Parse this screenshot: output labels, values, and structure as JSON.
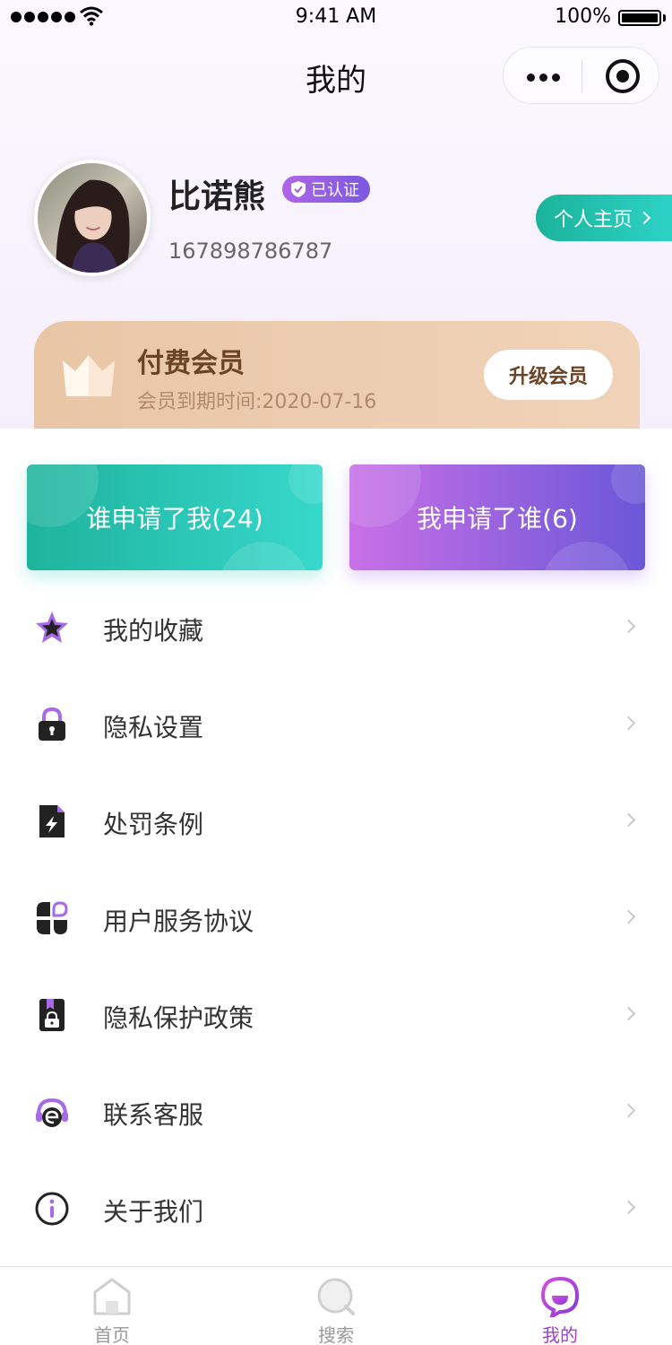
{
  "status_bar": {
    "time": "9:41 AM",
    "battery": "100%"
  },
  "nav": {
    "title": "我的"
  },
  "profile": {
    "name": "比诺熊",
    "verified_badge": "已认证",
    "phone": "167898786787",
    "homepage_label": "个人主页"
  },
  "membership": {
    "title": "付费会员",
    "expire": "会员到期时间:2020-07-16",
    "upgrade_label": "升级会员"
  },
  "apply": {
    "who_applied_me": "谁申请了我(24)",
    "i_applied_who": "我申请了谁(6)"
  },
  "menu": [
    {
      "label": "我的收藏",
      "icon": "star-icon"
    },
    {
      "label": "隐私设置",
      "icon": "lock-icon"
    },
    {
      "label": "处罚条例",
      "icon": "document-bolt-icon"
    },
    {
      "label": "用户服务协议",
      "icon": "grid-icon"
    },
    {
      "label": "隐私保护政策",
      "icon": "file-lock-icon"
    },
    {
      "label": "联系客服",
      "icon": "headset-icon"
    },
    {
      "label": "关于我们",
      "icon": "info-icon"
    }
  ],
  "tabs": [
    {
      "label": "首页",
      "icon": "home-icon",
      "active": false
    },
    {
      "label": "搜索",
      "icon": "search-icon",
      "active": false
    },
    {
      "label": "我的",
      "icon": "profile-icon",
      "active": true
    }
  ],
  "colors": {
    "accent_purple": "#a33dcf",
    "teal": "#1eb39c",
    "member_gold": "#e8c6a6"
  }
}
